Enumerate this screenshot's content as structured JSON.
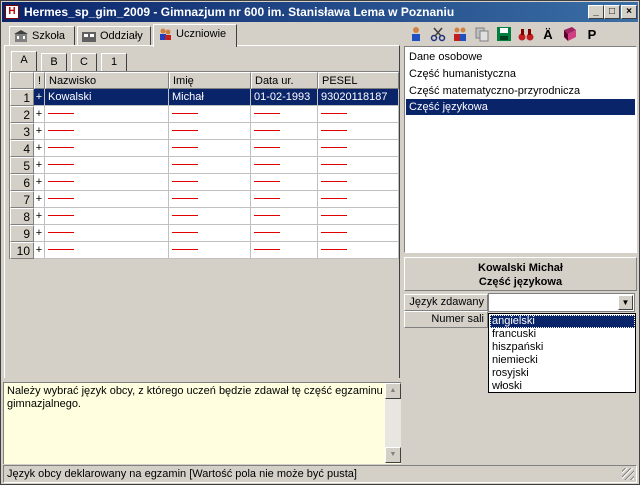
{
  "window": {
    "title": "Hermes_sp_gim_2009 - Gimnazjum nr 600 im. Stanisława Lema w Poznaniu"
  },
  "main_tabs": [
    {
      "label": "Szkoła",
      "icon": "school-icon"
    },
    {
      "label": "Oddziały",
      "icon": "classes-icon"
    },
    {
      "label": "Uczniowie",
      "icon": "students-icon"
    }
  ],
  "sub_tabs": [
    "A",
    "B",
    "C",
    "1"
  ],
  "grid": {
    "columns": [
      "!",
      "Nazwisko",
      "Imię",
      "Data ur.",
      "PESEL"
    ],
    "rows": [
      {
        "num": "1",
        "flag": "+",
        "surname": "Kowalski",
        "name": "Michał",
        "dob": "01-02-1993",
        "pesel": "93020118187"
      },
      {
        "num": "2",
        "flag": "+"
      },
      {
        "num": "3",
        "flag": "+"
      },
      {
        "num": "4",
        "flag": "+"
      },
      {
        "num": "5",
        "flag": "+"
      },
      {
        "num": "6",
        "flag": "+"
      },
      {
        "num": "7",
        "flag": "+"
      },
      {
        "num": "8",
        "flag": "+"
      },
      {
        "num": "9",
        "flag": "+"
      },
      {
        "num": "10",
        "flag": "+"
      }
    ]
  },
  "toolbar": {
    "icons": [
      "person-icon",
      "scissors-icon",
      "people-icon",
      "copy-icon",
      "save-icon",
      "binoculars-icon",
      "umlaut-a-icon",
      "book-icon",
      "p-icon"
    ],
    "a_umlaut_label": "Ä",
    "p_label": "P"
  },
  "sections": [
    "Dane osobowe",
    "Część humanistyczna",
    "Część matematyczno-przyrodnicza",
    "Część językowa"
  ],
  "detail": {
    "student": "Kowalski Michał",
    "section": "Część językowa",
    "language_label": "Język zdawany",
    "room_label": "Numer sali",
    "language_value": "",
    "options": [
      "angielski",
      "francuski",
      "hiszpański",
      "niemiecki",
      "rosyjski",
      "włoski"
    ]
  },
  "help": {
    "text": "Należy wybrać język obcy, z którego uczeń będzie zdawał tę część egzaminu gimnazjalnego."
  },
  "status": {
    "text": "Język obcy deklarowany na egzamin [Wartość pola nie może być pusta]"
  }
}
